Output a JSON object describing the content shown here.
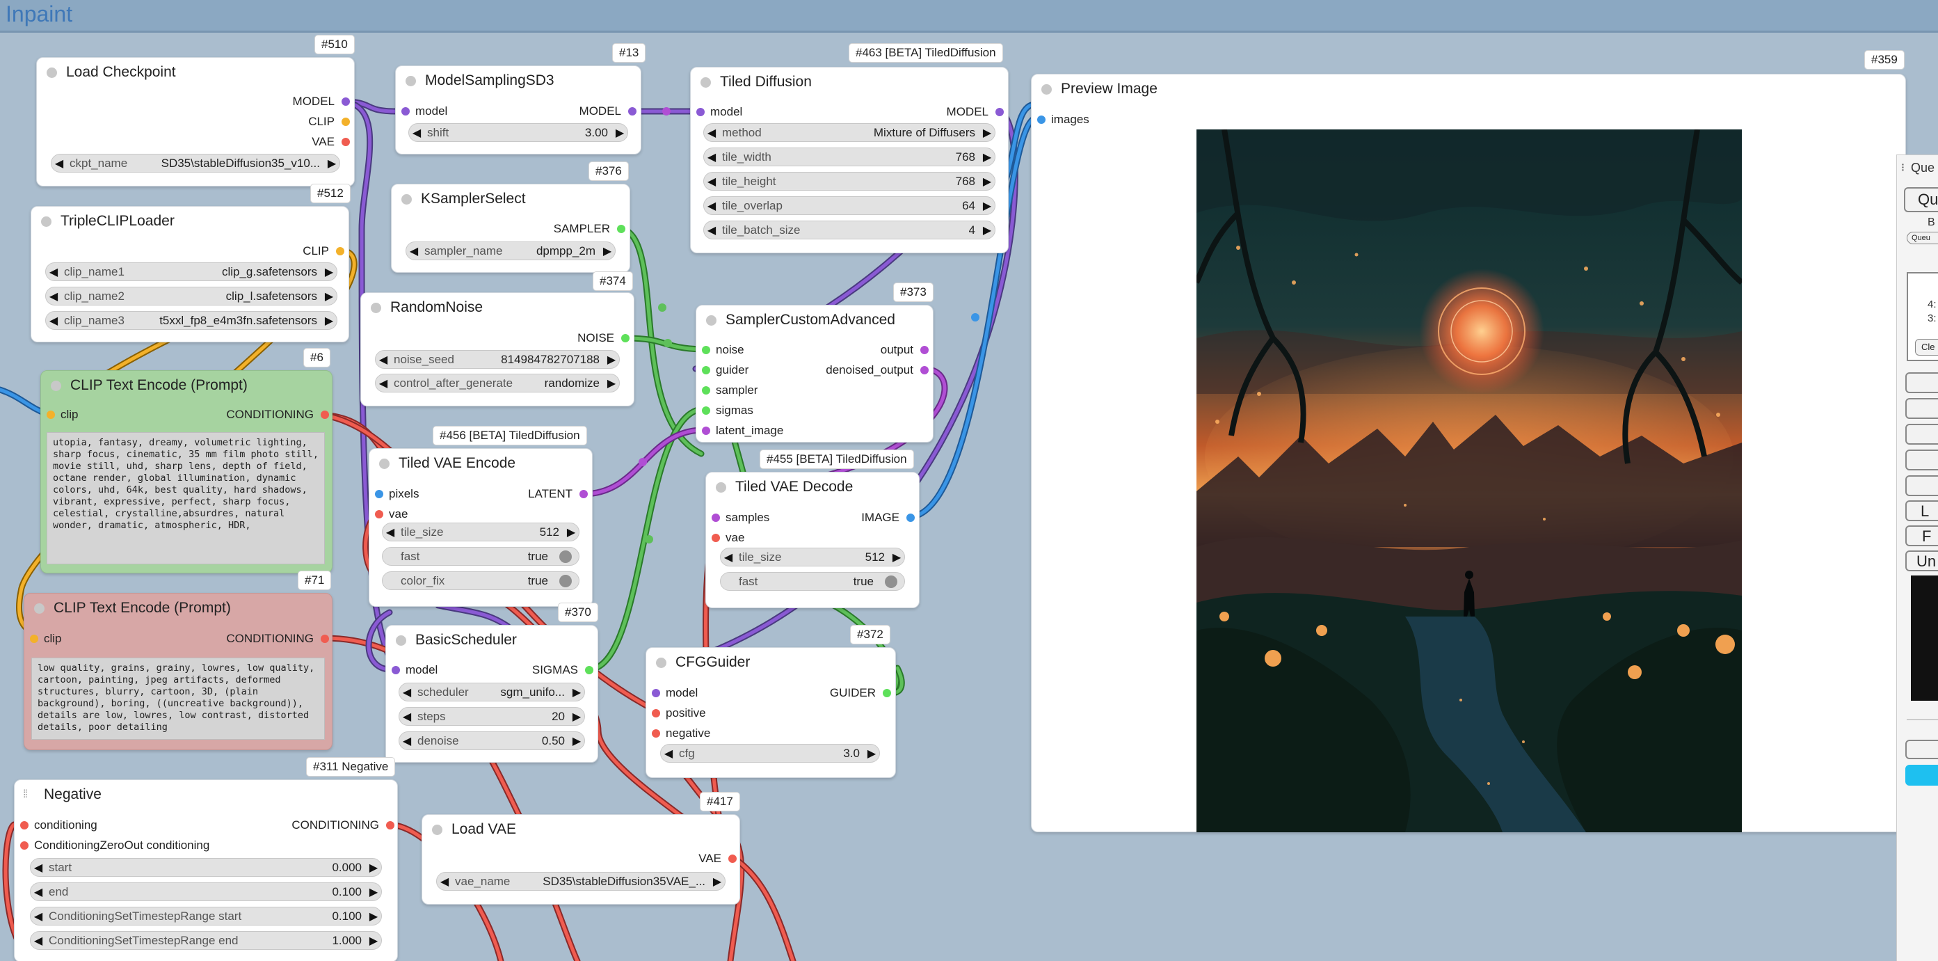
{
  "group": {
    "title": "Inpaint"
  },
  "colors": {
    "model": "#8a5ad4",
    "clip": "#f3b12a",
    "vae": "#f05c50",
    "conditioning": "#f05c50",
    "latent": "#b04ed4",
    "image": "#3a95e6",
    "sampler": "#5ee05a",
    "noise": "#5ee05a",
    "sigmas": "#5ee05a",
    "guider": "#5ee05a",
    "canvas": "#aabdce"
  },
  "nodes": {
    "load_checkpoint": {
      "id": "#510",
      "title": "Load Checkpoint",
      "outputs": [
        "MODEL",
        "CLIP",
        "VAE"
      ],
      "widgets": [
        {
          "name": "ckpt_name",
          "value": "SD35\\stableDiffusion35_v10..."
        }
      ]
    },
    "model_sampling": {
      "id": "#13",
      "title": "ModelSamplingSD3",
      "input": "model",
      "output": "MODEL",
      "widgets": [
        {
          "name": "shift",
          "value": "3.00"
        }
      ]
    },
    "tiled_diffusion": {
      "id": "#463 [BETA] TiledDiffusion",
      "title": "Tiled Diffusion",
      "input": "model",
      "output": "MODEL",
      "widgets": [
        {
          "name": "method",
          "value": "Mixture of Diffusers"
        },
        {
          "name": "tile_width",
          "value": "768"
        },
        {
          "name": "tile_height",
          "value": "768"
        },
        {
          "name": "tile_overlap",
          "value": "64"
        },
        {
          "name": "tile_batch_size",
          "value": "4"
        }
      ]
    },
    "preview": {
      "id": "#359",
      "title": "Preview Image",
      "input": "images"
    },
    "triple_clip": {
      "id": "#512",
      "title": "TripleCLIPLoader",
      "output": "CLIP",
      "widgets": [
        {
          "name": "clip_name1",
          "value": "clip_g.safetensors"
        },
        {
          "name": "clip_name2",
          "value": "clip_l.safetensors"
        },
        {
          "name": "clip_name3",
          "value": "t5xxl_fp8_e4m3fn.safetensors"
        }
      ]
    },
    "ksampler_select": {
      "id": "#376",
      "title": "KSamplerSelect",
      "output": "SAMPLER",
      "widgets": [
        {
          "name": "sampler_name",
          "value": "dpmpp_2m"
        }
      ]
    },
    "random_noise": {
      "id": "#374",
      "title": "RandomNoise",
      "output": "NOISE",
      "widgets": [
        {
          "name": "noise_seed",
          "value": "814984782707188"
        },
        {
          "name": "control_after_generate",
          "value": "randomize"
        }
      ]
    },
    "sampler_custom": {
      "id": "#373",
      "title": "SamplerCustomAdvanced",
      "inputs": [
        "noise",
        "guider",
        "sampler",
        "sigmas",
        "latent_image"
      ],
      "outputs": [
        "output",
        "denoised_output"
      ]
    },
    "clip_pos": {
      "id": "#6",
      "title": "CLIP Text Encode (Prompt)",
      "input": "clip",
      "output": "CONDITIONING",
      "text": "utopia, fantasy, dreamy, volumetric lighting, sharp focus, cinematic, 35 mm film photo still, movie still, uhd, sharp lens, depth of field, octane render, global illumination, dynamic colors, uhd, 64k, best quality, hard shadows, vibrant, expressive, perfect, sharp focus, celestial, crystalline,absurdres, natural wonder, dramatic, atmospheric, HDR,"
    },
    "tiled_vae_encode": {
      "id": "#456 [BETA] TiledDiffusion",
      "title": "Tiled VAE Encode",
      "inputs": [
        "pixels",
        "vae"
      ],
      "output": "LATENT",
      "widgets": [
        {
          "name": "tile_size",
          "value": "512"
        },
        {
          "name": "fast",
          "value": "true"
        },
        {
          "name": "color_fix",
          "value": "true"
        }
      ]
    },
    "tiled_vae_decode": {
      "id": "#455 [BETA] TiledDiffusion",
      "title": "Tiled VAE Decode",
      "inputs": [
        "samples",
        "vae"
      ],
      "output": "IMAGE",
      "widgets": [
        {
          "name": "tile_size",
          "value": "512"
        },
        {
          "name": "fast",
          "value": "true"
        }
      ]
    },
    "clip_neg": {
      "id": "#71",
      "title": "CLIP Text Encode (Prompt)",
      "input": "clip",
      "output": "CONDITIONING",
      "text": "low quality, grains, grainy, lowres, low quality, cartoon, painting, jpeg artifacts, deformed structures, blurry, cartoon, 3D, (plain background), boring, ((uncreative background)), details are low, lowres, low contrast, distorted details, poor detailing"
    },
    "basic_scheduler": {
      "id": "#370",
      "title": "BasicScheduler",
      "input": "model",
      "output": "SIGMAS",
      "widgets": [
        {
          "name": "scheduler",
          "value": "sgm_unifo..."
        },
        {
          "name": "steps",
          "value": "20"
        },
        {
          "name": "denoise",
          "value": "0.50"
        }
      ]
    },
    "cfg_guider": {
      "id": "#372",
      "title": "CFGGuider",
      "inputs": [
        "model",
        "positive",
        "negative"
      ],
      "output": "GUIDER",
      "widgets": [
        {
          "name": "cfg",
          "value": "3.0"
        }
      ]
    },
    "negative": {
      "id": "#311 Negative",
      "title": "Negative",
      "inputs": [
        "conditioning",
        "ConditioningZeroOut conditioning"
      ],
      "output": "CONDITIONING",
      "widgets": [
        {
          "name": "start",
          "value": "0.000"
        },
        {
          "name": "end",
          "value": "0.100"
        },
        {
          "name": "ConditioningSetTimestepRange start",
          "value": "0.100"
        },
        {
          "name": "ConditioningSetTimestepRange end",
          "value": "1.000"
        }
      ]
    },
    "load_vae": {
      "id": "#417",
      "title": "Load VAE",
      "output": "VAE",
      "widgets": [
        {
          "name": "vae_name",
          "value": "SD35\\stableDiffusion35VAE_..."
        }
      ]
    }
  },
  "queue_panel": {
    "header": "Que",
    "queue_btn": "Qu",
    "b_label": "B",
    "small_btn": "Queu",
    "list_items": [
      "4:",
      "3:"
    ],
    "clear_btn": "Cle",
    "btn_l": "L",
    "btn_f": "F",
    "btn_un": "Un"
  }
}
